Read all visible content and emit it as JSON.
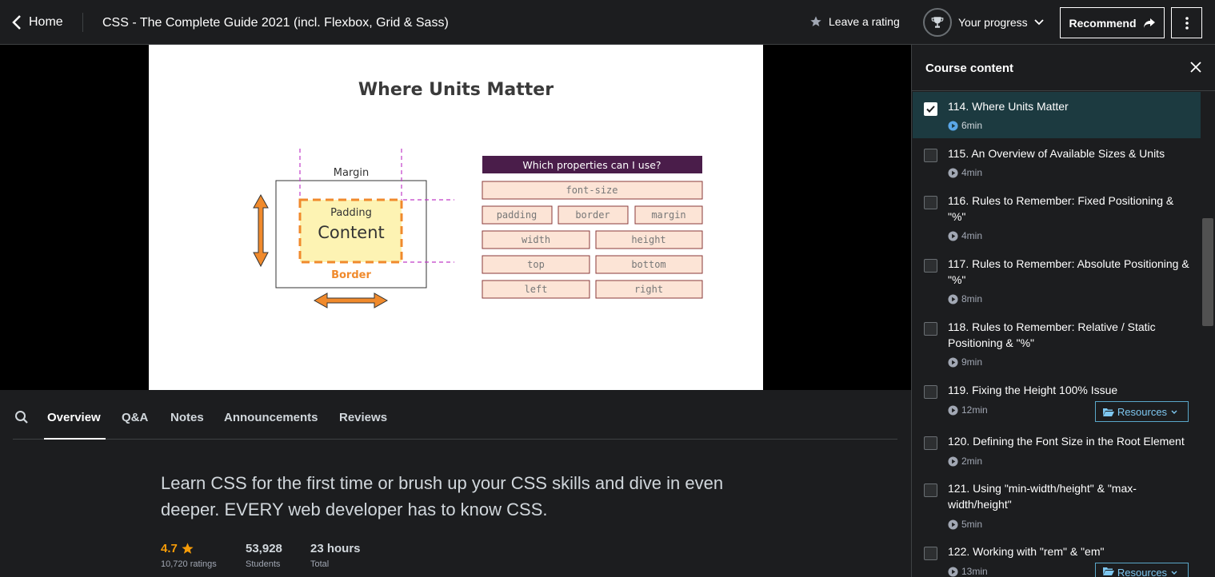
{
  "topbar": {
    "home_label": "Home",
    "course_title": "CSS - The Complete Guide 2021 (incl. Flexbox, Grid & Sass)",
    "rating_label": "Leave a rating",
    "progress_label": "Your progress",
    "recommend_label": "Recommend"
  },
  "slide": {
    "title": "Where Units Matter",
    "box_labels": {
      "margin": "Margin",
      "padding": "Padding",
      "content": "Content",
      "border": "Border"
    },
    "table_header": "Which properties can I use?",
    "properties": [
      "font-size",
      "padding",
      "border",
      "margin",
      "width",
      "height",
      "top",
      "bottom",
      "left",
      "right"
    ],
    "colors": {
      "header_bg": "#4a1d4a",
      "cell_bg": "#fce4d6",
      "accent_orange": "#f08a2c",
      "content_fill": "#fdf3b3",
      "guide_magenta": "#c03cc8"
    }
  },
  "tabs": {
    "items": [
      "Overview",
      "Q&A",
      "Notes",
      "Announcements",
      "Reviews"
    ],
    "active": "Overview"
  },
  "overview": {
    "tagline": "Learn CSS for the first time or brush up your CSS skills and dive in even deeper. EVERY web developer has to know CSS.",
    "rating": "4.7",
    "ratings_count": "10,720 ratings",
    "students": "53,928",
    "students_label": "Students",
    "hours": "23 hours",
    "hours_label": "Total"
  },
  "sidebar": {
    "title": "Course content",
    "items": [
      {
        "title": "114. Where Units Matter",
        "duration": "6min",
        "checked": true,
        "current": true
      },
      {
        "title": "115. An Overview of Available Sizes & Units",
        "duration": "4min"
      },
      {
        "title": "116. Rules to Remember: Fixed Positioning & \"%\"",
        "duration": "4min"
      },
      {
        "title": "117. Rules to Remember: Absolute Positioning & \"%\"",
        "duration": "8min"
      },
      {
        "title": "118. Rules to Remember: Relative / Static Positioning & \"%\"",
        "duration": "9min"
      },
      {
        "title": "119. Fixing the Height 100% Issue",
        "duration": "12min",
        "resources": "Resources"
      },
      {
        "title": "120. Defining the Font Size in the Root Element",
        "duration": "2min"
      },
      {
        "title": "121. Using \"min-width/height\" & \"max-width/height\"",
        "duration": "5min"
      },
      {
        "title": "122. Working with \"rem\" & \"em\"",
        "duration": "13min",
        "resources": "Resources"
      }
    ]
  }
}
